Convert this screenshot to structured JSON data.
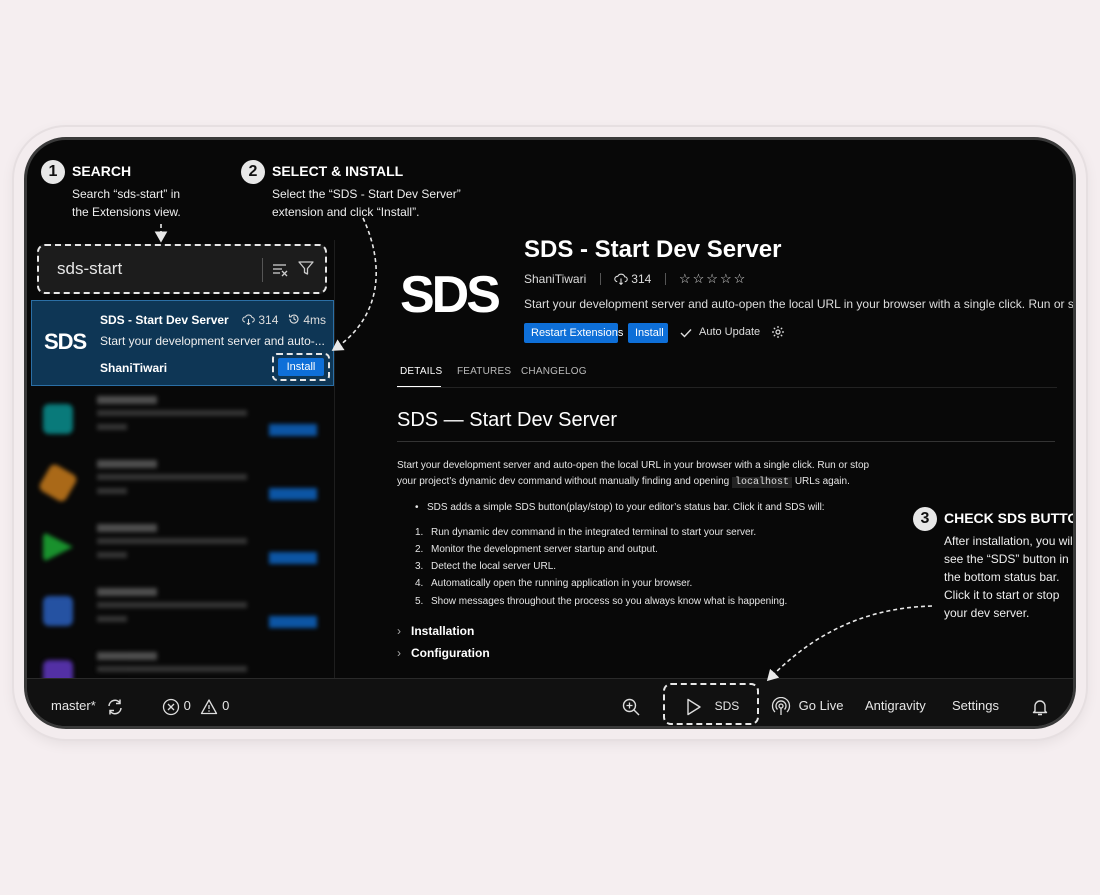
{
  "steps": [
    {
      "num": "1",
      "title": "SEARCH",
      "desc": [
        "Search “sds-start” in",
        "the Extensions view."
      ]
    },
    {
      "num": "2",
      "title": "SELECT & INSTALL",
      "desc": [
        "Select the “SDS - Start Dev Server”",
        "extension and click “Install”."
      ]
    },
    {
      "num": "3",
      "title": "CHECK SDS BUTTON",
      "desc": [
        "After installation, you will",
        "see the “SDS” button in",
        "the bottom status bar.",
        "Click it to start or stop",
        "your dev server."
      ]
    }
  ],
  "search": {
    "value": "sds-start",
    "icons": [
      "clear-filter-icon",
      "filter-icon"
    ]
  },
  "selected_extension": {
    "logo": "SDS",
    "name": "SDS - Start Dev Server",
    "downloads": "314",
    "time": "4ms",
    "description": "Start your development server and auto-...",
    "author": "ShaniTiwari",
    "install_label": "Install"
  },
  "detail": {
    "logo": "SDS",
    "title": "SDS - Start Dev Server",
    "author": "ShaniTiwari",
    "downloads": "314",
    "rating": "☆☆☆☆☆",
    "description": "Start your development server and auto-open the local URL in your browser with a single click. Run or stop ...",
    "restart_label": "Restart Extensions",
    "install_label": "Install",
    "auto_update_label": "Auto Update",
    "tabs": [
      "DETAILS",
      "FEATURES",
      "CHANGELOG"
    ],
    "heading": "SDS — Start Dev Server",
    "para_line1": "Start your development server and auto-open the local URL in your browser with a single click. Run or stop",
    "para_line2_a": "your project’s dynamic dev command without manually finding and opening",
    "para_code": "localhost",
    "para_line2_b": "URLs again.",
    "bullet": "SDS adds a simple SDS button(play/stop) to your editor’s status bar. Click it and SDS will:",
    "steps": [
      "Run dynamic dev command in the integrated terminal to start your server.",
      "Monitor the development server startup and output.",
      "Detect the local server URL.",
      "Automatically open the running application in your browser.",
      "Show messages throughout the process so you always know what is happening."
    ],
    "sections": [
      "Installation",
      "Configuration"
    ]
  },
  "statusbar": {
    "branch": "master*",
    "errors": "0",
    "warnings": "0",
    "sds_label": "SDS",
    "golive_label": "Go Live",
    "antigravity_label": "Antigravity",
    "settings_label": "Settings"
  }
}
